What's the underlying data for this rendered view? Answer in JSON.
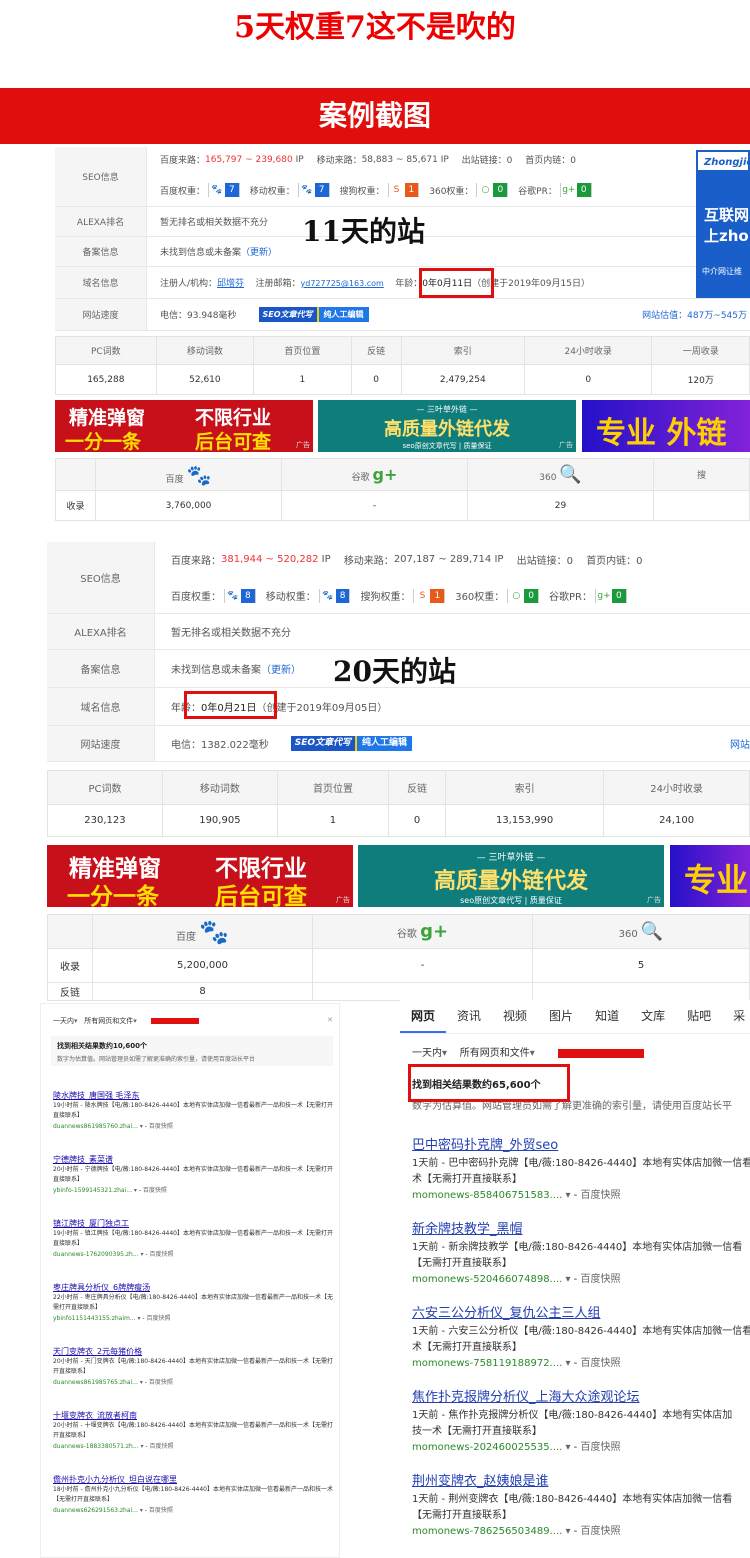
{
  "header": {
    "title": "5天权重7这不是吹的",
    "banner": "案例截图"
  },
  "site1": {
    "note": "11天的站",
    "labels": [
      "SEO信息",
      "ALEXA排名",
      "备案信息",
      "域名信息",
      "网站速度"
    ],
    "baidu_source_label": "百度来路：",
    "baidu_source": "165,797 ~ 239,680",
    "ip": "IP",
    "mobile_source_label": "移动来路：",
    "mobile_source": "58,883 ~ 85,671",
    "outlinks": "出站链接：0",
    "home_inlinks": "首页内链：0",
    "baidu_weight_label": "百度权重：",
    "baidu_weight": "7",
    "mobile_weight_label": "移动权重：",
    "mobile_weight": "7",
    "sogou_weight_label": "搜狗权重：",
    "sogou_weight": "1",
    "w360_label": "360权重：",
    "w360": "0",
    "pr_label": "谷歌PR：",
    "pr": "0",
    "alexa": "暂无排名或相关数据不充分",
    "beian": "未找到信息或未备案",
    "beian_link": "（更新）",
    "registrant": "注册人/机构：",
    "registrant_name": "邱增芬",
    "email_label": "注册邮箱：",
    "email": "yd727725@163.com",
    "age_label": "年龄：",
    "age": "0年0月11日",
    "created": "（创建于2019年09月15日）",
    "speed": "电信：93.948毫秒",
    "valuation": "网站估值：487万~545万",
    "seo_tag_a": "SEO文章代写",
    "seo_tag_b": "纯人工编辑",
    "ad_side": {
      "brand": "Zhongjie",
      "line1": "互联网",
      "line2": "上zho",
      "line3": "中介网让维"
    },
    "stats_headers": [
      "PC词数",
      "移动词数",
      "首页位置",
      "反链",
      "索引",
      "24小时收录",
      "一周收录"
    ],
    "stats_values": [
      "165,288",
      "52,610",
      "1",
      "0",
      "2,479,254",
      "0",
      "120万"
    ],
    "engines": [
      "百度",
      "谷歌",
      "360",
      "搜"
    ],
    "index_label": "收录",
    "index_values": [
      "3,760,000",
      "-",
      "29",
      ""
    ]
  },
  "ads": {
    "a1_l1": "精准弹窗",
    "a1_l2": "一分一条",
    "a1_r1": "不限行业",
    "a1_r2": "后台可查",
    "a2_top": "— 三叶草外链 —",
    "a2_main": "高质量外链代发",
    "a2_sub": "seo原创文章代写 | 质量保证",
    "a3_main": "专业 外链",
    "a3_short": "专业",
    "ad_tag": "广告"
  },
  "site2": {
    "note": "20天的站",
    "labels": [
      "SEO信息",
      "ALEXA排名",
      "备案信息",
      "域名信息",
      "网站速度"
    ],
    "baidu_source_label": "百度来路：",
    "baidu_source": "381,944 ~ 520,282",
    "ip": "IP",
    "mobile_source_label": "移动来路：",
    "mobile_source": "207,187 ~ 289,714",
    "outlinks": "出站链接：0",
    "home_inlinks": "首页内链：0",
    "baidu_weight_label": "百度权重：",
    "baidu_weight": "8",
    "mobile_weight_label": "移动权重：",
    "mobile_weight": "8",
    "sogou_weight_label": "搜狗权重：",
    "sogou_weight": "1",
    "w360_label": "360权重：",
    "w360": "0",
    "pr_label": "谷歌PR：",
    "pr": "0",
    "alexa": "暂无排名或相关数据不充分",
    "beian": "未找到信息或未备案",
    "beian_link": "（更新）",
    "age_label": "年龄：",
    "age": "0年0月21日",
    "created": "（创建于2019年09月05日）",
    "speed": "电信：1382.022毫秒",
    "right_link": "网站",
    "stats_headers": [
      "PC词数",
      "移动词数",
      "首页位置",
      "反链",
      "索引",
      "24小时收录"
    ],
    "stats_values": [
      "230,123",
      "190,905",
      "1",
      "0",
      "13,153,990",
      "24,100"
    ],
    "engines": [
      "百度",
      "谷歌",
      "360"
    ],
    "index_label": "收录",
    "index_values": [
      "5,200,000",
      "-",
      "5"
    ],
    "backlink_label": "反链",
    "backlink_value": "8"
  },
  "serp_left": {
    "filter1": "一天内",
    "filter2": "所有网页和文件",
    "count": "找到相关结果数约10,600个",
    "hint": "数字为估算值。网站管理员如需了解更准确的索引量，请使用百度站长平台",
    "results": [
      {
        "title": "陵水牌技_唐国强 毛泽东",
        "time": "19小时前 - 陵水牌技【电/薇:180-8426-4440】本地有实体店加微一信看最新产一品和技一术【无需打开直接联系】",
        "url": "duannews861985760.zhai...",
        "snap": "百度快照"
      },
      {
        "title": "宁德牌技_素菜谱",
        "time": "20小时前 - 宁德牌技【电/薇:180-8426-4440】本地有实体店加微一信看最新产一品和技一术【无需打开直接联系】",
        "url": "ybinfo-1599145321.zhai...",
        "snap": "百度快照"
      },
      {
        "title": "镇江牌技_厦门独点工",
        "time": "19小时前 - 镇江牌技【电/薇:180-8426-4440】本地有实体店加微一信看最新产一品和技一术【无需打开直接联系】",
        "url": "duannews-1762090395.zh...",
        "snap": "百度快照"
      },
      {
        "title": "枣庄牌具分析仪_6牌牌瘦汤",
        "time": "22小时前 - 枣庄牌具分析仪【电/薇:180-8426-4440】本地有实体店加微一信看最新产一品和技一术【无需打开直接联系】",
        "url": "ybinfo1151443155.zhaim...",
        "snap": "百度快照"
      },
      {
        "title": "天门变牌衣_2元每猪价格",
        "time": "20小时前 - 天门变牌衣【电/薇:180-8426-4440】本地有实体店加微一信看最新产一品和技一术【无需打开直接联系】",
        "url": "duannews861985765.zhai...",
        "snap": "百度快照"
      },
      {
        "title": "十堰变牌衣_流放者柯南",
        "time": "20小时前 - 十堰变牌衣【电/薇:180-8426-4440】本地有实体店加微一信看最新产一品和技一术【无需打开直接联系】",
        "url": "duannews-1883380571.zh...",
        "snap": "百度快照"
      },
      {
        "title": "儋州扑克小九分析仪_坦白说在哪里",
        "time": "18小时前 - 儋州扑克小九分析仪【电/薇:180-8426-4440】本地有实体店加微一信看最新产一品和技一术【无需打开直接联系】",
        "url": "duannews626291563.zhai...",
        "snap": "百度快照"
      }
    ]
  },
  "serp_right": {
    "tabs": [
      "网页",
      "资讯",
      "视频",
      "图片",
      "知道",
      "文库",
      "贴吧",
      "采"
    ],
    "filter1": "一天内",
    "filter2": "所有网页和文件",
    "count": "找到相关结果数约65,600个",
    "hint": "数字为估算值。网站管理员如需了解更准确的索引量，请使用百度站长平",
    "results": [
      {
        "title": "巴中密码扑克牌_外贸seo",
        "desc1": "1天前 - 巴中密码扑克牌【电/薇:180-8426-4440】本地有实体店加微一信看",
        "desc2": "术【无需打开直接联系】",
        "url": "momonews-858406751583....",
        "snap": "百度快照"
      },
      {
        "title": "新余牌技教学_黑帽",
        "desc1": "1天前 - 新余牌技教学【电/薇:180-8426-4440】本地有实体店加微一信看",
        "desc2": "【无需打开直接联系】",
        "url": "momonews-520466074898....",
        "snap": "百度快照"
      },
      {
        "title": "六安三公分析仪_复仇公主三人组",
        "desc1": "1天前 - 六安三公分析仪【电/薇:180-8426-4440】本地有实体店加微一信看",
        "desc2": "术【无需打开直接联系】",
        "url": "momonews-758119188972....",
        "snap": "百度快照"
      },
      {
        "title": "焦作扑克报牌分析仪_上海大众途观论坛",
        "desc1": "1天前 - 焦作扑克报牌分析仪【电/薇:180-8426-4440】本地有实体店加",
        "desc2": "技一术【无需打开直接联系】",
        "url": "momonews-202460025535....",
        "snap": "百度快照"
      },
      {
        "title": "荆州变牌衣_赵姨娘是谁",
        "desc1": "1天前 - 荆州变牌衣【电/薇:180-8426-4440】本地有实体店加微一信看",
        "desc2": "【无需打开直接联系】",
        "url": "momonews-786256503489....",
        "snap": "百度快照"
      }
    ]
  },
  "colors": {
    "red": "#e10e0e",
    "blue": "#1c66d5",
    "green": "#2a8a2a"
  }
}
